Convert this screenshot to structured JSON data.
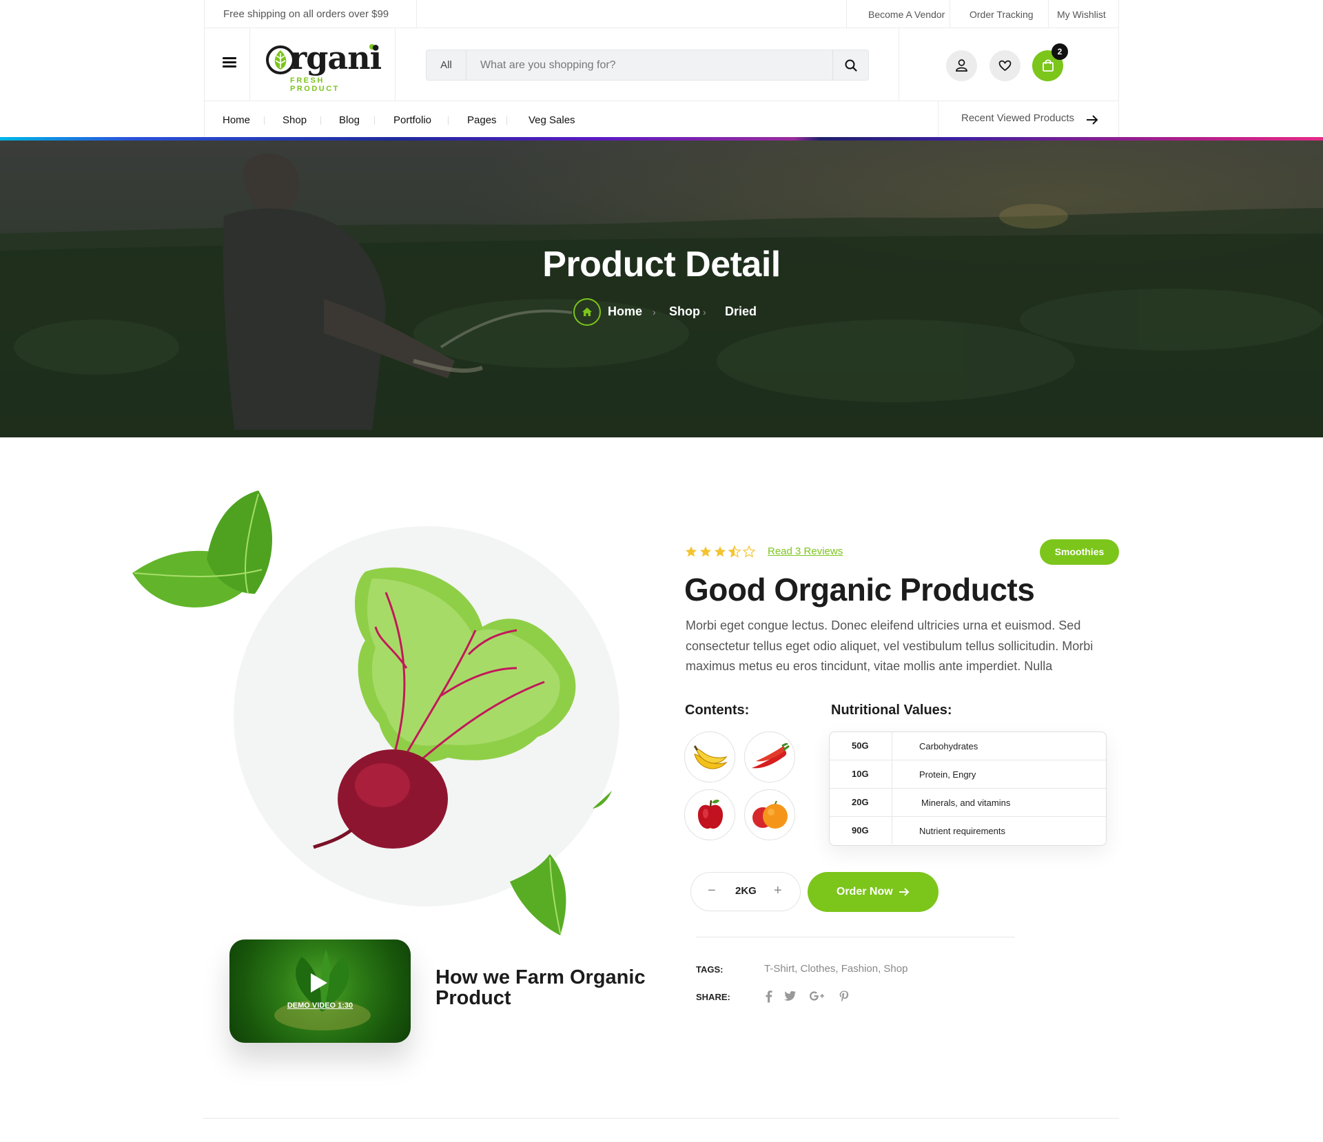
{
  "topbar": {
    "shipping": "Free shipping on all orders over $99",
    "links": [
      "Become A Vendor",
      "Order Tracking",
      "My Wishlist"
    ]
  },
  "header": {
    "logo_word": "rgani",
    "logo_tagline": "FRESH PRODUCT",
    "search": {
      "category": "All",
      "placeholder": "What are you shopping for?"
    },
    "cart_count": "2",
    "icons": [
      "menu-icon",
      "search-icon",
      "user-icon",
      "heart-icon",
      "bag-icon"
    ]
  },
  "nav": {
    "items": [
      "Home",
      "Shop",
      "Blog",
      "Portfolio",
      "Pages",
      "Veg Sales"
    ],
    "recent": "Recent Viewed Products"
  },
  "hero": {
    "title": "Product Detail",
    "breadcrumb": [
      "Home",
      "Shop",
      "Dried"
    ]
  },
  "product": {
    "rating": 3.5,
    "reviews_link": "Read 3 Reviews",
    "category_pill": "Smoothies",
    "title": "Good Organic Products",
    "description": "Morbi eget congue lectus. Donec eleifend ultricies urna et euismod. Sed consectetur tellus eget odio aliquet, vel vestibulum tellus sollicitudin. Morbi maximus metus eu eros tincidunt, vitae mollis ante imperdiet. Nulla",
    "contents_heading": "Contents:",
    "contents": [
      "banana",
      "chili",
      "apple",
      "orange"
    ],
    "nutrition_heading": "Nutritional Values:",
    "nutrition": [
      {
        "amount": "50G",
        "label": "Carbohydrates"
      },
      {
        "amount": "10G",
        "label": "Protein, Engry"
      },
      {
        "amount": "20G",
        "label": "Minerals, and vitamins"
      },
      {
        "amount": "90G",
        "label": "Nutrient requirements"
      }
    ],
    "quantity": "2KG",
    "order_button": "Order Now",
    "tags_label": "TAGS:",
    "tags": "T-Shirt, Clothes, Fashion, Shop",
    "share_label": "SHARE:",
    "share_icons": [
      "facebook-icon",
      "twitter-icon",
      "google-plus-icon",
      "pinterest-icon"
    ]
  },
  "video": {
    "label": "DEMO VIDEO 1:30",
    "heading": "How we Farm Organic Product"
  },
  "colors": {
    "accent": "#7cc51b",
    "dark": "#1c1c1c"
  }
}
